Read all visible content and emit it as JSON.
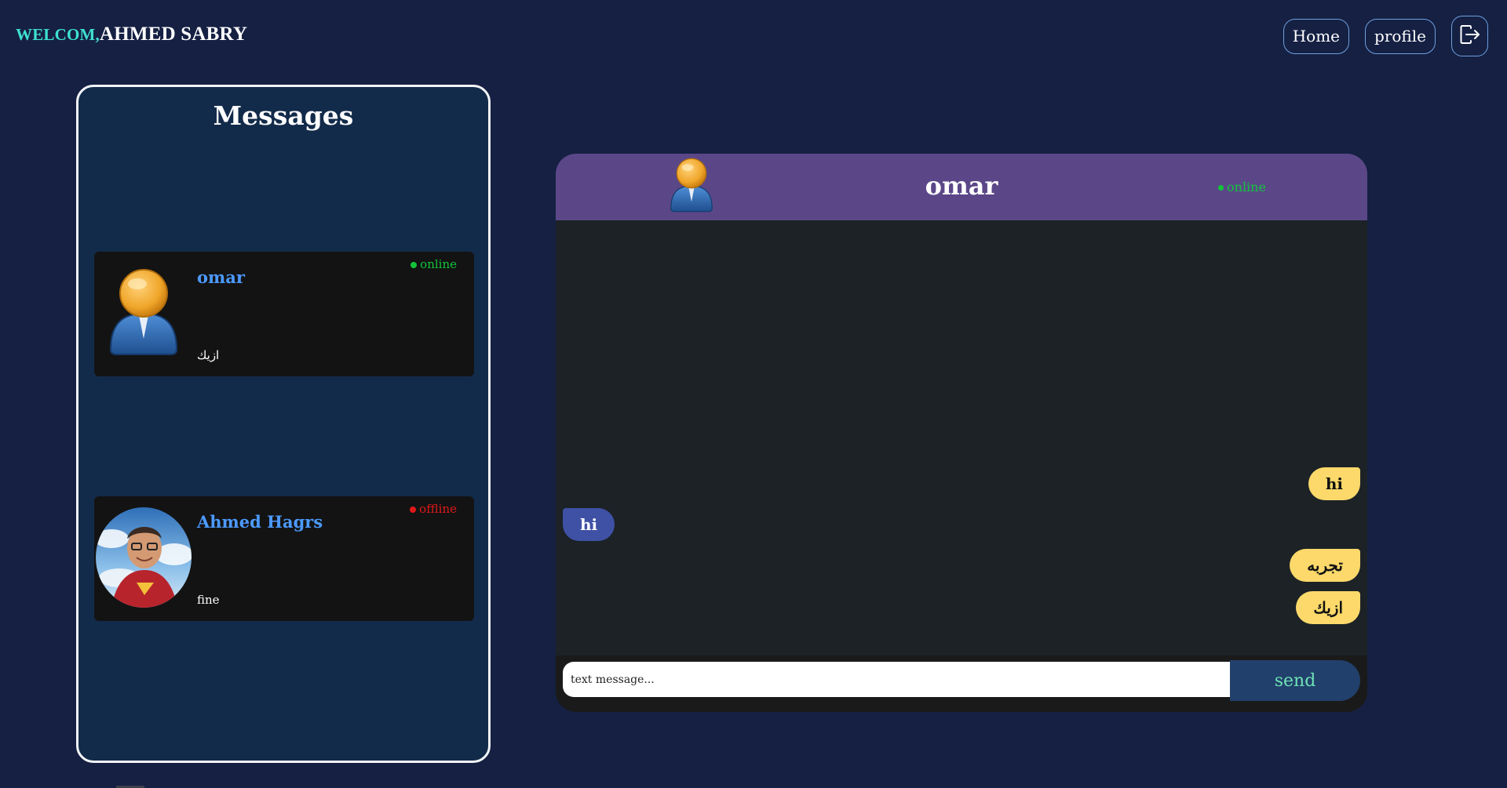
{
  "header": {
    "welcome_prefix": "WELCOM,",
    "user_name": "AHMED SABRY",
    "nav": {
      "home_label": "Home",
      "profile_label": "profile",
      "logout_icon": "logout-icon"
    }
  },
  "messages_panel": {
    "title": "Messages",
    "contacts": [
      {
        "name": "omar",
        "status": "online",
        "last_message": "ازيك",
        "avatar": "default-user-avatar"
      },
      {
        "name": "Ahmed Hagrs",
        "status": "offline",
        "last_message": "fine",
        "avatar": "user-photo-avatar"
      }
    ]
  },
  "chat": {
    "contact_name": "omar",
    "contact_status": "online",
    "messages": [
      {
        "text": "hi",
        "direction": "sent"
      },
      {
        "text": "hi",
        "direction": "received"
      },
      {
        "text": "تجربه",
        "direction": "sent"
      },
      {
        "text": "ازيك",
        "direction": "sent"
      }
    ],
    "input": {
      "placeholder": "text message...",
      "value": ""
    },
    "send_label": "send"
  },
  "colors": {
    "background": "#152043",
    "panel": "#132b4a",
    "chat_header": "#5b4788",
    "sent_bubble": "#fcd96a",
    "received_bubble": "#3f51a5",
    "online": "#12c43a",
    "offline": "#e01818",
    "accent_name": "#4c9aff",
    "welcome_prefix": "#3fe0d0"
  }
}
